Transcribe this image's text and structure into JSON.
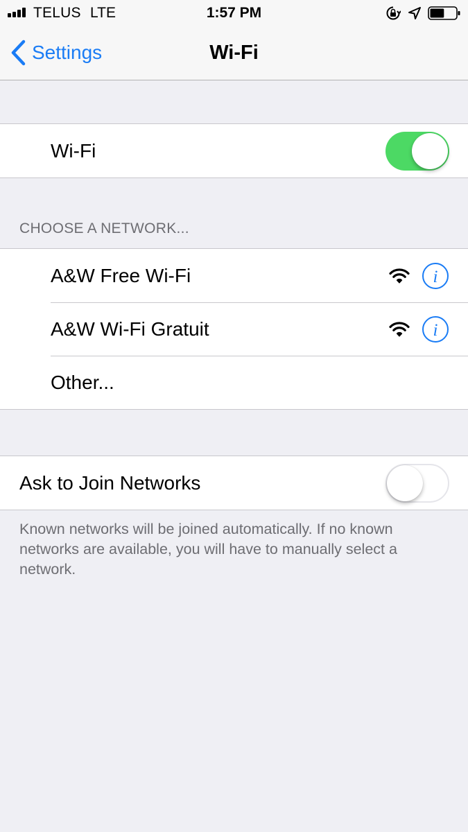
{
  "status_bar": {
    "carrier": "TELUS",
    "network": "LTE",
    "time": "1:57 PM",
    "signal_bars": 4,
    "battery_level": 0.55
  },
  "nav": {
    "back_label": "Settings",
    "title": "Wi-Fi"
  },
  "wifi_toggle": {
    "label": "Wi-Fi",
    "enabled": true
  },
  "networks": {
    "header": "CHOOSE A NETWORK...",
    "items": [
      {
        "name": "A&W Free Wi-Fi",
        "signal": "full"
      },
      {
        "name": "A&W Wi-Fi Gratuit",
        "signal": "full"
      }
    ],
    "other_label": "Other..."
  },
  "ask_to_join": {
    "label": "Ask to Join Networks",
    "enabled": false,
    "footer": "Known networks will be joined automatically. If no known networks are available, you will have to manually select a network."
  },
  "colors": {
    "accent": "#1a7cf5",
    "toggle_on": "#4cd964",
    "background": "#efeff4",
    "secondary_text": "#6d6d72"
  },
  "icons": [
    "signal-icon",
    "lock-rotation-icon",
    "location-icon",
    "battery-icon",
    "chevron-left-icon",
    "wifi-icon",
    "info-icon"
  ]
}
